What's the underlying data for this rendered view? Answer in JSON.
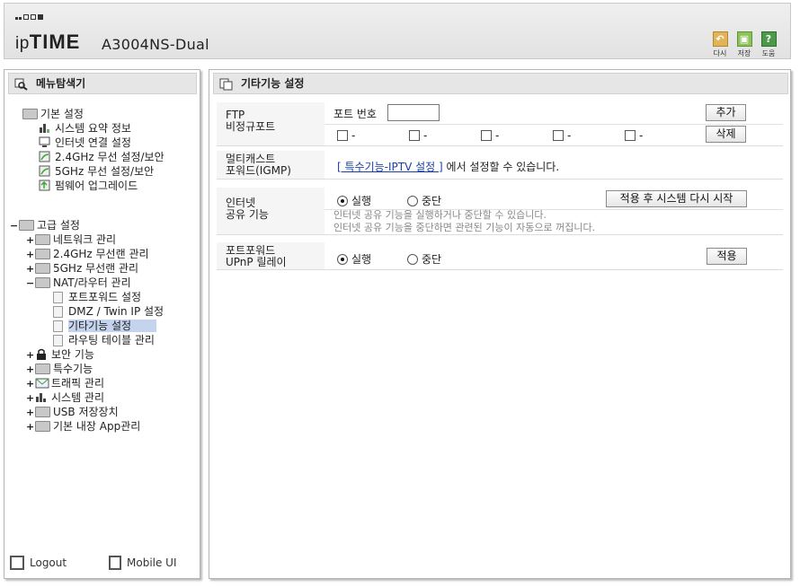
{
  "header": {
    "brand_prefix": "ip",
    "brand_suffix": "TIME",
    "model": "A3004NS-Dual",
    "buttons": [
      {
        "label": "다시",
        "icon": "undo-icon",
        "color": "#d9a84a"
      },
      {
        "label": "저장",
        "icon": "save-icon",
        "color": "#7ab648"
      },
      {
        "label": "도움",
        "icon": "help-icon",
        "color": "#4a9a4a"
      }
    ]
  },
  "sidebar": {
    "title": "메뉴탐색기",
    "basic": {
      "label": "기본 설정",
      "items": [
        "시스템 요약 정보",
        "인터넷 연결 설정",
        "2.4GHz 무선 설정/보안",
        "5GHz 무선 설정/보안",
        "펌웨어 업그레이드"
      ]
    },
    "advanced": {
      "label": "고급 설정",
      "items": [
        "네트워크 관리",
        "2.4GHz 무선랜 관리",
        "5GHz 무선랜 관리",
        "NAT/라우터 관리"
      ],
      "nat_children": [
        "포트포워드 설정",
        "DMZ / Twin IP 설정",
        "기타기능 설정",
        "라우팅 테이블 관리"
      ],
      "more": [
        "보안 기능",
        "특수기능",
        "트래픽 관리",
        "시스템 관리",
        "USB 저장장치",
        "기본 내장 App관리"
      ]
    },
    "footer": {
      "logout": "Logout",
      "mobile": "Mobile UI"
    }
  },
  "main": {
    "title": "기타기능 설정",
    "ftp": {
      "label_line1": "FTP",
      "label_line2": "비정규포트",
      "port_label": "포트 번호",
      "port_value": "",
      "add_button": "추가",
      "delete_button": "삭제",
      "slots": [
        "-",
        "-",
        "-",
        "-",
        "-"
      ]
    },
    "multicast": {
      "label_line1": "멀티캐스트",
      "label_line2": "포워드(IGMP)",
      "link_text": "[ 특수기능-IPTV 설정 ]",
      "text": "에서 설정할 수 있습니다."
    },
    "sharing": {
      "label_line1": "인터넷",
      "label_line2": "공유 기능",
      "on": "실행",
      "off": "중단",
      "apply_restart_button": "적용 후 시스템 다시 시작",
      "note1": "인터넷 공유 기능을 실행하거나 중단할 수 있습니다.",
      "note2": "인터넷 공유 기능을 중단하면 관련된 기능이 자동으로 꺼집니다."
    },
    "upnp": {
      "label_line1": "포트포워드",
      "label_line2": "UPnP 릴레이",
      "on": "실행",
      "off": "중단",
      "apply_button": "적용"
    }
  }
}
